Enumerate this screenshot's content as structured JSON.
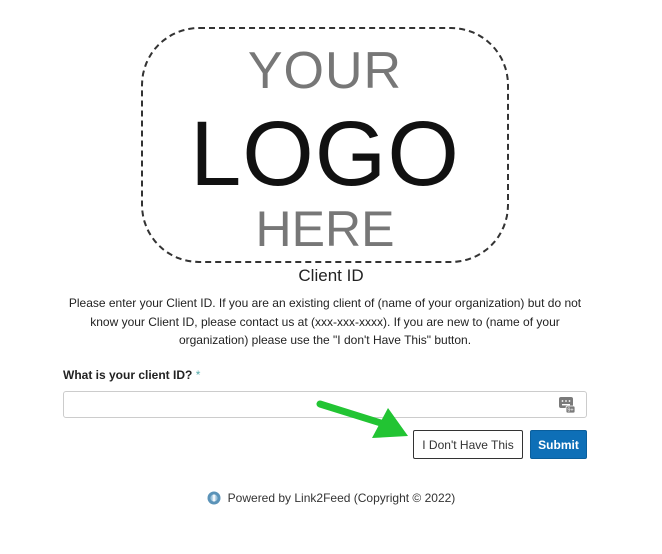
{
  "logo": {
    "line1": "YOUR",
    "line2": "LOGO",
    "line3": "HERE"
  },
  "form": {
    "title": "Client ID",
    "instructions": "Please enter your Client ID. If you are an existing client of (name of your organization) but do not know your Client ID, please contact us at (xxx-xxx-xxxx). If you are new to (name of your organization) please use the \"I don't Have This\" button.",
    "question_label": "What is your client ID?",
    "required_marker": "*",
    "client_id_value": "",
    "client_id_placeholder": "",
    "input_icon": "keyboard-icon",
    "dont_have_button": "I Don't Have This",
    "submit_button": "Submit"
  },
  "annotation": {
    "arrow_icon": "green-arrow-icon",
    "arrow_color": "#22c433"
  },
  "footer": {
    "text": "Powered by Link2Feed (Copyright © 2022)",
    "icon": "link2feed-logo-icon"
  },
  "colors": {
    "primary_button": "#0e6fb7",
    "required_marker": "#5aa"
  }
}
